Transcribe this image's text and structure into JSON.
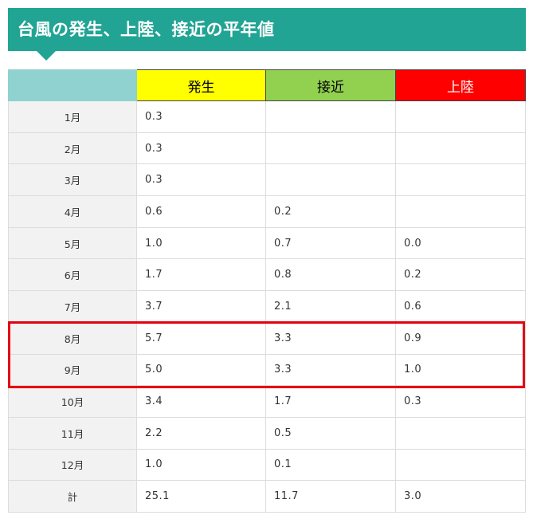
{
  "title": "台風の発生、上陸、接近の平年値",
  "colors": {
    "heading_bg": "#21a494",
    "corner_bg": "#8fd2d0",
    "col1_bg": "#ffff00",
    "col2_bg": "#92d050",
    "col3_bg": "#ff0000",
    "col1_text": "#000000",
    "col2_text": "#000000",
    "col3_text": "#ffffff",
    "highlight": "#e60012"
  },
  "columns": [
    "発生",
    "接近",
    "上陸"
  ],
  "rows": [
    {
      "month": "1月",
      "values": [
        "0.3",
        "",
        ""
      ]
    },
    {
      "month": "2月",
      "values": [
        "0.3",
        "",
        ""
      ]
    },
    {
      "month": "3月",
      "values": [
        "0.3",
        "",
        ""
      ]
    },
    {
      "month": "4月",
      "values": [
        "0.6",
        "0.2",
        ""
      ]
    },
    {
      "month": "5月",
      "values": [
        "1.0",
        "0.7",
        "0.0"
      ]
    },
    {
      "month": "6月",
      "values": [
        "1.7",
        "0.8",
        "0.2"
      ]
    },
    {
      "month": "7月",
      "values": [
        "3.7",
        "2.1",
        "0.6"
      ]
    },
    {
      "month": "8月",
      "values": [
        "5.7",
        "3.3",
        "0.9"
      ]
    },
    {
      "month": "9月",
      "values": [
        "5.0",
        "3.3",
        "1.0"
      ]
    },
    {
      "month": "10月",
      "values": [
        "3.4",
        "1.7",
        "0.3"
      ]
    },
    {
      "month": "11月",
      "values": [
        "2.2",
        "0.5",
        ""
      ]
    },
    {
      "month": "12月",
      "values": [
        "1.0",
        "0.1",
        ""
      ]
    },
    {
      "month": "計",
      "values": [
        "25.1",
        "11.7",
        "3.0"
      ]
    }
  ],
  "highlighted_months": [
    "8月",
    "9月"
  ]
}
